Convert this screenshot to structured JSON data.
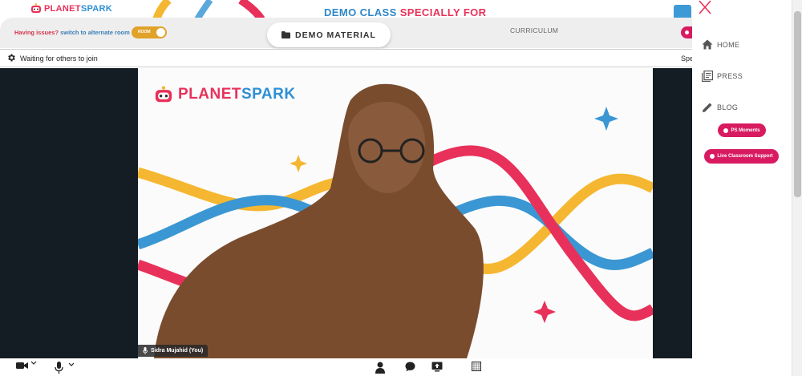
{
  "header": {
    "logo": {
      "part1": "PLANET",
      "part2": "SPARK"
    },
    "demo_title": {
      "part1": "DEMO CLASS",
      "part2": "SPECIALLY FOR"
    }
  },
  "banner": {
    "issue_text": "Having issues?",
    "switch_text": "switch to alternate room",
    "toggle_label": "ROOM",
    "demo_material": "DEMO MATERIAL",
    "curriculum": "CURRICULUM"
  },
  "status": {
    "waiting_text": "Waiting for others to join",
    "right_text": "Spe"
  },
  "video": {
    "logo": {
      "part1": "PLANET",
      "part2": "SPARK"
    },
    "participant_name": "Sidra Mujahid (You)"
  },
  "sidenav": {
    "items": [
      {
        "label": "HOME",
        "icon": "home-icon"
      },
      {
        "label": "PRESS",
        "icon": "newspaper-icon"
      },
      {
        "label": "BLOG",
        "icon": "pencil-icon"
      }
    ],
    "ps_moments": "PS Moments",
    "live_support": "Live Classroom Support"
  },
  "colors": {
    "brand_pink": "#e8315a",
    "brand_blue": "#2d8fd5",
    "accent_magenta": "#d81b60",
    "toggle_yellow": "#e1a22a",
    "stage_dark": "#151d24"
  }
}
